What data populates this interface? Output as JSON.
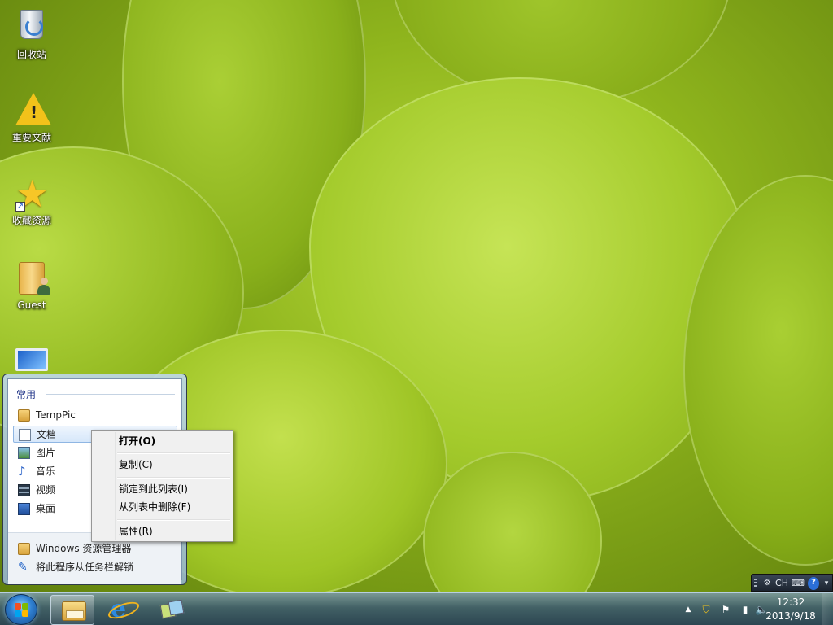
{
  "desktop": {
    "icons": [
      {
        "label": "回收站",
        "icon": "recycle-bin-icon"
      },
      {
        "label": "重要文献",
        "icon": "warning-icon"
      },
      {
        "label": "收藏资源",
        "icon": "star-shortcut-icon"
      },
      {
        "label": "Guest",
        "icon": "user-folder-icon"
      },
      {
        "label": "",
        "icon": "computer-icon"
      }
    ]
  },
  "jumplist": {
    "header": "常用",
    "items": [
      {
        "label": "TempPic",
        "icon": "folder-icon"
      },
      {
        "label": "文档",
        "icon": "documents-icon"
      },
      {
        "label": "图片",
        "icon": "pictures-icon"
      },
      {
        "label": "音乐",
        "icon": "music-icon"
      },
      {
        "label": "视频",
        "icon": "videos-icon"
      },
      {
        "label": "桌面",
        "icon": "desktop-icon"
      }
    ],
    "tasks": [
      {
        "label": "Windows 资源管理器",
        "icon": "explorer-icon"
      },
      {
        "label": "将此程序从任务栏解锁",
        "icon": "unpin-icon"
      }
    ]
  },
  "context_menu": {
    "items": [
      {
        "label": "打开(O)",
        "bold": true
      },
      {
        "label": "复制(C)"
      },
      {
        "label": "锁定到此列表(I)"
      },
      {
        "label": "从列表中删除(F)"
      },
      {
        "label": "属性(R)"
      }
    ]
  },
  "language_bar": {
    "lang": "CH",
    "help": "?"
  },
  "taskbar": {
    "apps": [
      {
        "name": "Windows Explorer",
        "icon": "explorer-folder-icon",
        "active": true
      },
      {
        "name": "Internet Explorer",
        "icon": "ie-icon",
        "active": false
      },
      {
        "name": "Desktop Switcher",
        "icon": "switcher-icon",
        "active": false
      }
    ],
    "clock": {
      "time": "12:32",
      "date": "2013/9/18"
    }
  },
  "colors": {
    "accent_blue": "#1e3287",
    "wallpaper_green": "#9fc526"
  }
}
